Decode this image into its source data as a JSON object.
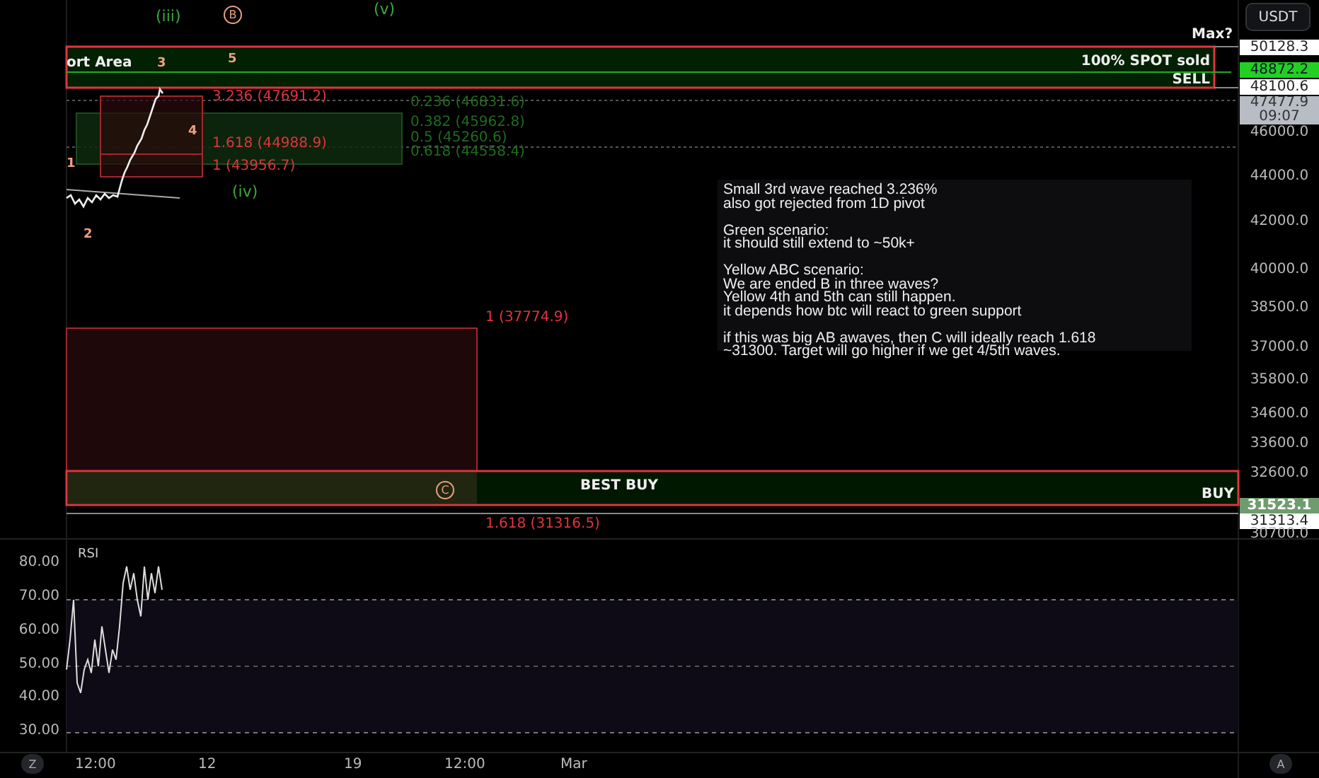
{
  "toolbar": {
    "currency_button": "USDT"
  },
  "main_pane": {
    "wave_labels": [
      {
        "text": "(iii)",
        "kind": "green"
      },
      {
        "text": "B",
        "kind": "circled"
      },
      {
        "text": "(v)",
        "kind": "green"
      },
      {
        "text": "3",
        "kind": "plain"
      },
      {
        "text": "5",
        "kind": "plain"
      },
      {
        "text": "4",
        "kind": "plain"
      },
      {
        "text": "1",
        "kind": "plain"
      },
      {
        "text": "2",
        "kind": "plain"
      },
      {
        "text": "(iv)",
        "kind": "green"
      },
      {
        "text": "C",
        "kind": "circled"
      }
    ],
    "zone_labels": [
      "ort Area",
      "Max?",
      "100% SPOT sold",
      "SELL",
      "BEST BUY",
      "BUY"
    ],
    "fib_labels": [
      {
        "text": "3.236 (47691.2)",
        "kind": "red"
      },
      {
        "text": "1.618 (44988.9)",
        "kind": "red"
      },
      {
        "text": "1 (43956.7)",
        "kind": "red"
      },
      {
        "text": "0.236 (46831.6)",
        "kind": "green"
      },
      {
        "text": "0.382 (45962.8)",
        "kind": "green"
      },
      {
        "text": "0.5 (45260.6)",
        "kind": "green"
      },
      {
        "text": "0.618 (44558.4)",
        "kind": "green"
      },
      {
        "text": "1 (37774.9)",
        "kind": "red"
      },
      {
        "text": "1.618 (31316.5)",
        "kind": "red"
      }
    ],
    "note": {
      "paragraphs": [
        "Small 3rd wave reached 3.236%\nalso got rejected from 1D pivot",
        "Green scenario:\nit should still extend to ~50k+",
        "Yellow ABC scenario:\nWe are ended B in three waves?\nYellow 4th and 5th can still happen.\nit depends how btc will react to green support",
        "if this was big AB awaves, then C will ideally reach 1.618\n~31300. Target will go higher if we get 4/5th waves."
      ]
    }
  },
  "price_axis": {
    "labels": [
      {
        "text": "50128.3",
        "kind": "tag"
      },
      {
        "text": "48872.2",
        "kind": "tag-green"
      },
      {
        "text": "48100.6",
        "kind": "tag"
      },
      {
        "text": "47477.9\n09:07",
        "kind": "tag-grey"
      },
      {
        "text": "46000.0",
        "kind": "tick"
      },
      {
        "text": "44000.0",
        "kind": "tick"
      },
      {
        "text": "42000.0",
        "kind": "tick"
      },
      {
        "text": "40000.0",
        "kind": "tick"
      },
      {
        "text": "38500.0",
        "kind": "tick"
      },
      {
        "text": "37000.0",
        "kind": "tick"
      },
      {
        "text": "35800.0",
        "kind": "tick"
      },
      {
        "text": "34600.0",
        "kind": "tick"
      },
      {
        "text": "33600.0",
        "kind": "tick"
      },
      {
        "text": "32600.0",
        "kind": "tick"
      },
      {
        "text": "31523.1",
        "kind": "tag-dim"
      },
      {
        "text": "31313.4",
        "kind": "tag"
      },
      {
        "text": "30700.0",
        "kind": "tick"
      }
    ]
  },
  "rsi_pane": {
    "title": "RSI",
    "axis_labels": [
      "80.00",
      "70.00",
      "60.00",
      "50.00",
      "40.00",
      "30.00"
    ]
  },
  "time_axis": {
    "left_button": "Z",
    "labels": [
      "12:00",
      "12",
      "19",
      "12:00",
      "Mar"
    ],
    "right_button": "A"
  }
}
